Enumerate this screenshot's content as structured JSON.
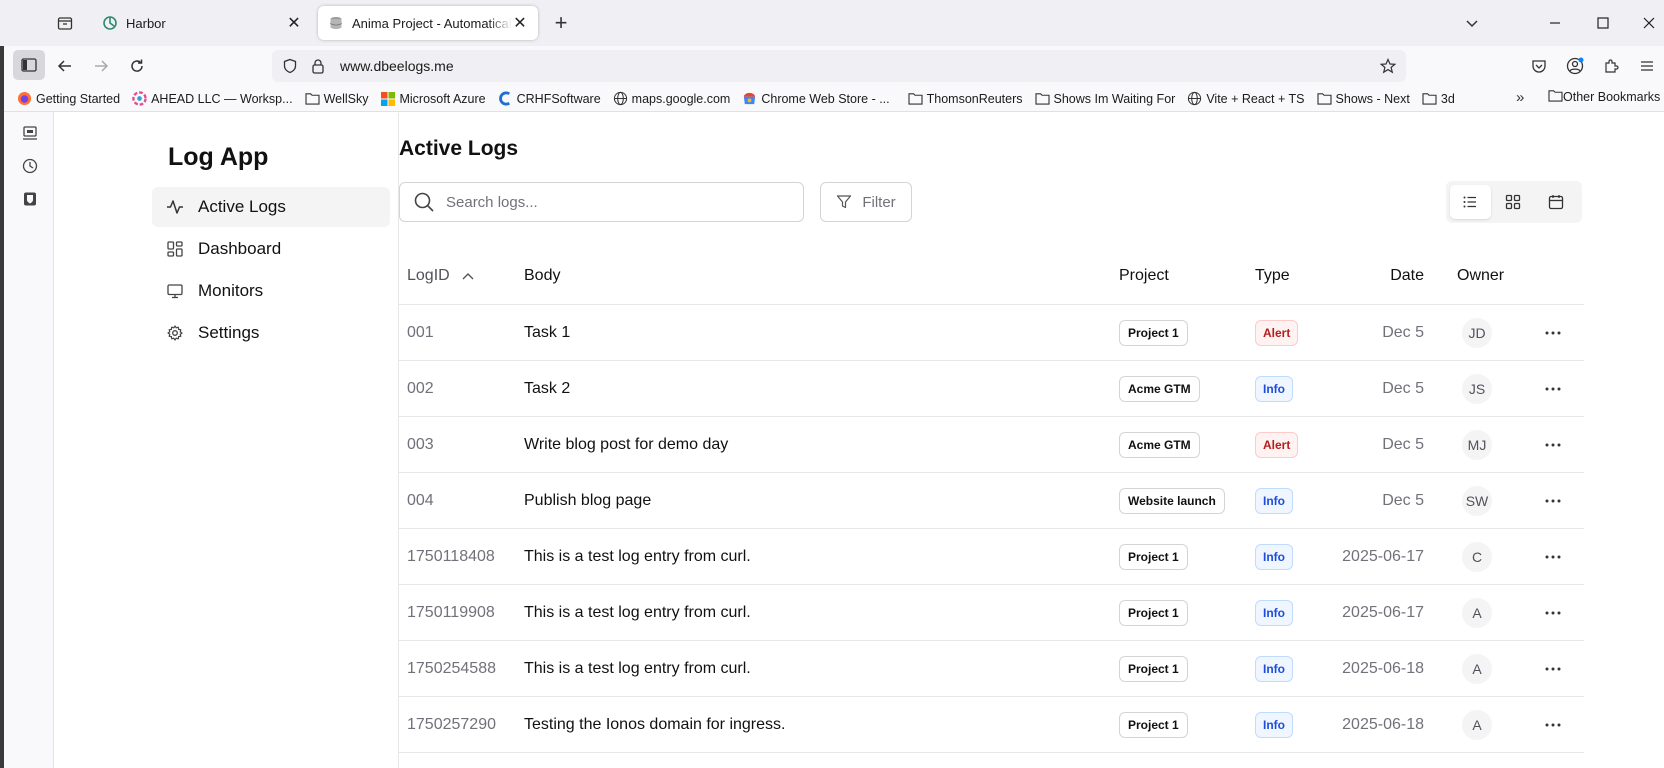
{
  "browser": {
    "tabs": [
      {
        "title": "Harbor",
        "favicon": "harbor-icon"
      },
      {
        "title": "Anima Project - Automatically generated",
        "favicon": "database-icon"
      }
    ],
    "url": "www.dbeelogs.me",
    "bookmarks": [
      {
        "label": "Getting Started",
        "icon": "firefox-icon"
      },
      {
        "label": "AHEAD LLC — Worksp...",
        "icon": "ahead-icon"
      },
      {
        "label": "WellSky",
        "icon": "folder-icon"
      },
      {
        "label": "Microsoft Azure",
        "icon": "microsoft-icon"
      },
      {
        "label": "CRHFSoftware",
        "icon": "crhf-icon"
      },
      {
        "label": "maps.google.com",
        "icon": "globe-icon"
      },
      {
        "label": "Chrome Web Store - ...",
        "icon": "chrome-store-icon"
      },
      {
        "label": "ThomsonReuters",
        "icon": "folder-icon"
      },
      {
        "label": "Shows Im Waiting For",
        "icon": "folder-icon"
      },
      {
        "label": "Vite + React + TS",
        "icon": "globe-icon"
      },
      {
        "label": "Shows - Next",
        "icon": "folder-icon"
      },
      {
        "label": "3d",
        "icon": "folder-icon"
      }
    ],
    "other_bookmarks": "Other Bookmarks"
  },
  "app": {
    "title": "Log App",
    "nav": [
      {
        "label": "Active Logs",
        "icon": "activity-icon",
        "active": true
      },
      {
        "label": "Dashboard",
        "icon": "dashboard-icon",
        "active": false
      },
      {
        "label": "Monitors",
        "icon": "monitor-icon",
        "active": false
      },
      {
        "label": "Settings",
        "icon": "gear-icon",
        "active": false
      }
    ]
  },
  "main": {
    "title": "Active Logs",
    "search_placeholder": "Search logs...",
    "filter_label": "Filter",
    "columns": {
      "logid": "LogID",
      "body": "Body",
      "project": "Project",
      "type": "Type",
      "date": "Date",
      "owner": "Owner"
    },
    "rows": [
      {
        "logid": "001",
        "body": "Task 1",
        "project": "Project 1",
        "type": "Alert",
        "date": "Dec 5",
        "owner": "JD"
      },
      {
        "logid": "002",
        "body": "Task 2",
        "project": "Acme GTM",
        "type": "Info",
        "date": "Dec 5",
        "owner": "JS"
      },
      {
        "logid": "003",
        "body": "Write blog post for demo day",
        "project": "Acme GTM",
        "type": "Alert",
        "date": "Dec 5",
        "owner": "MJ"
      },
      {
        "logid": "004",
        "body": "Publish blog page",
        "project": "Website launch",
        "type": "Info",
        "date": "Dec 5",
        "owner": "SW"
      },
      {
        "logid": "1750118408",
        "body": "This is a test log entry from curl.",
        "project": "Project 1",
        "type": "Info",
        "date": "2025-06-17",
        "owner": "C"
      },
      {
        "logid": "1750119908",
        "body": "This is a test log entry from curl.",
        "project": "Project 1",
        "type": "Info",
        "date": "2025-06-17",
        "owner": "A"
      },
      {
        "logid": "1750254588",
        "body": "This is a test log entry from curl.",
        "project": "Project 1",
        "type": "Info",
        "date": "2025-06-18",
        "owner": "A"
      },
      {
        "logid": "1750257290",
        "body": "Testing the Ionos domain for ingress.",
        "project": "Project 1",
        "type": "Info",
        "date": "2025-06-18",
        "owner": "A"
      }
    ]
  }
}
